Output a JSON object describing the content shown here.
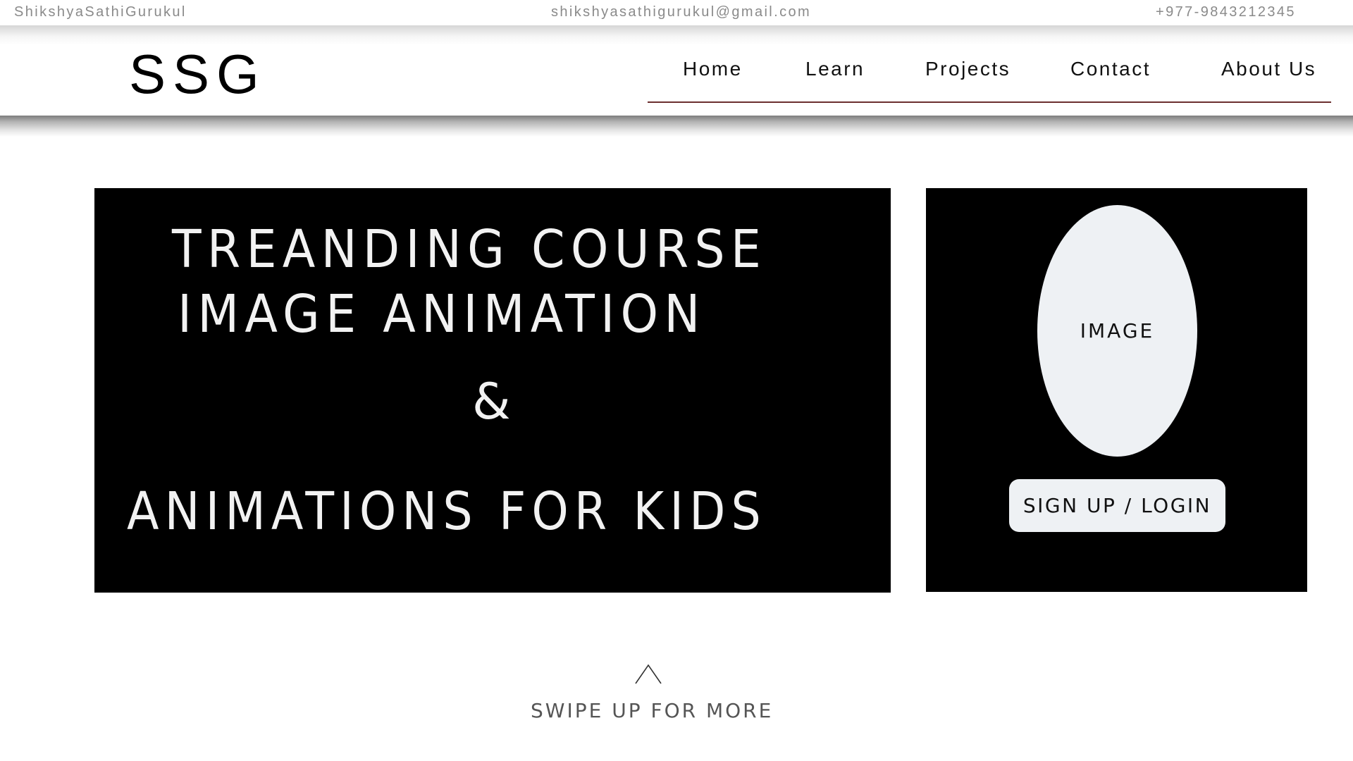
{
  "topbar": {
    "brand": "ShikshyaSathiGurukul",
    "email": "shikshyasathigurukul@gmail.com",
    "phone": "+977-9843212345"
  },
  "header": {
    "logo": "SSG",
    "nav": {
      "home": "Home",
      "learn": "Learn",
      "projects": "Projects",
      "contact": "Contact",
      "about": "About Us"
    },
    "nav_underline_color": "#6b2f2f"
  },
  "hero": {
    "line1": "TREANDING COURSE",
    "line2": "IMAGE ANIMATION",
    "ampersand": "&",
    "line3": "ANIMATIONS FOR KIDS",
    "background_color": "#000000",
    "text_color": "#f2f2f2"
  },
  "card": {
    "image_placeholder": "IMAGE",
    "signup_label": "SIGN UP / LOGIN",
    "background_color": "#000000",
    "shape_color": "#eef1f4"
  },
  "swipe": {
    "icon": "chevron-up-icon",
    "label": "SWIPE UP FOR MORE"
  }
}
